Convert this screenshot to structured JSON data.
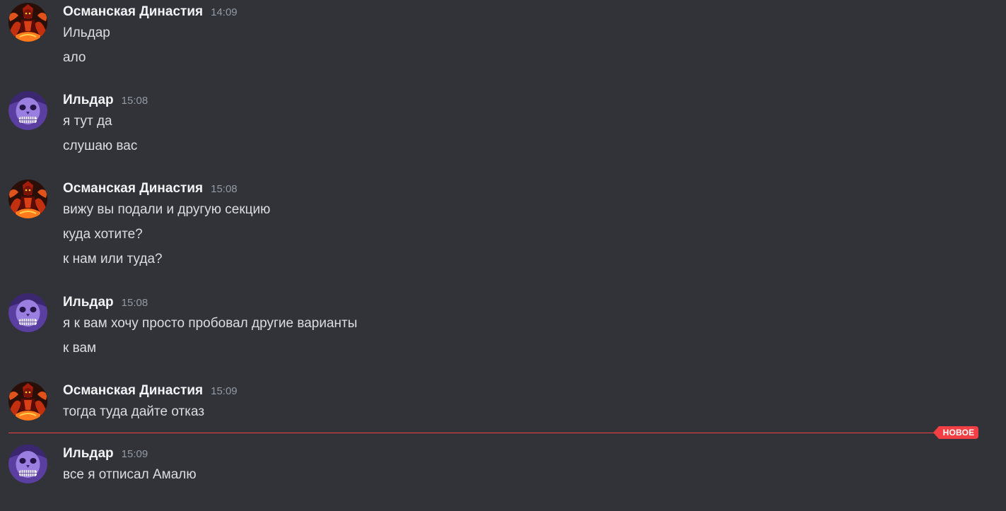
{
  "colors": {
    "background": "#313338",
    "username": "#f2f3f5",
    "message_text": "#dbdee1",
    "timestamp": "#949ba4",
    "new_divider": "#f23f43"
  },
  "messages": [
    {
      "author": "Османская Династия",
      "time": "14:09",
      "avatar": "red-demon-avatar",
      "lines": [
        "Ильдар",
        "ало"
      ]
    },
    {
      "author": "Ильдар",
      "time": "15:08",
      "avatar": "purple-skull-avatar",
      "lines": [
        "я тут да",
        "слушаю вас"
      ]
    },
    {
      "author": "Османская Династия",
      "time": "15:08",
      "avatar": "red-demon-avatar",
      "lines": [
        "вижу вы подали и другую секцию",
        "куда хотите?",
        "к нам или туда?"
      ]
    },
    {
      "author": "Ильдар",
      "time": "15:08",
      "avatar": "purple-skull-avatar",
      "lines": [
        "я к вам хочу просто пробовал другие варианты",
        "к вам"
      ]
    },
    {
      "author": "Османская Династия",
      "time": "15:09",
      "avatar": "red-demon-avatar",
      "lines": [
        "тогда туда дайте отказ"
      ]
    },
    {
      "author": "Ильдар",
      "time": "15:09",
      "avatar": "purple-skull-avatar",
      "lines": [
        "все я отписал Амалю"
      ]
    }
  ],
  "new_divider_label": "НОВОЕ"
}
